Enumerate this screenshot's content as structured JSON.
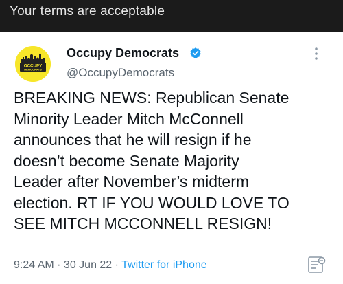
{
  "top_bar": {
    "title": "Your terms are acceptable"
  },
  "tweet": {
    "avatar": {
      "text": "OCCUPY DEMOCRATS",
      "color": "#f7e62a"
    },
    "display_name": "Occupy Democrats",
    "handle": "@OccupyDemocrats",
    "verified_color": "#1d9bf0",
    "text_lines": [
      "BREAKING NEWS: Republican Senate",
      "Minority Leader Mitch McConnell",
      "announces that he will resign if he",
      "doesn’t become Senate Majority",
      "Leader after November’s midterm",
      "election. RT IF YOU WOULD LOVE TO",
      "SEE MITCH MCCONNELL RESIGN!"
    ],
    "time": "9:24 AM",
    "separator": " · ",
    "date": "30 Jun 22",
    "source": "Twitter for iPhone",
    "icons": [
      "more-icon",
      "analytics-icon",
      "verified-icon"
    ]
  }
}
